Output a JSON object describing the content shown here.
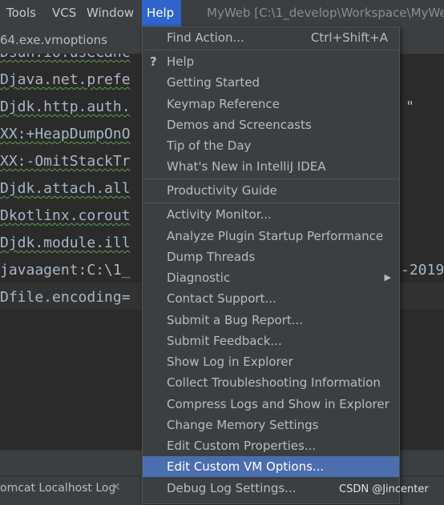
{
  "menubar": {
    "items": [
      {
        "label": "Tools"
      },
      {
        "label": "VCS"
      },
      {
        "label": "Window"
      },
      {
        "label": "Help"
      }
    ],
    "window_title": "MyWeb [C:\\1_develop\\Workspace\\MyWe"
  },
  "editor": {
    "tab_label": "64.exe.vmoptions",
    "lines": [
      "Dsun.io.useCanc",
      "Djava.net.prefe",
      "Djdk.http.auth.",
      "XX:+HeapDumpOnO",
      "XX:-OmitStackTr",
      "Djdk.attach.all",
      "Dkotlinx.corout",
      "Djdk.module.ill",
      "javaagent:C:\\1_",
      "Dfile.encoding="
    ],
    "right_fragments": {
      "quote": "\"",
      "javaagent_tail": "-2019"
    }
  },
  "bottom": {
    "tab_label": "omcat Localhost Log",
    "close_glyph": "✕"
  },
  "help_menu": {
    "items": [
      {
        "label": "Find Action...",
        "shortcut": "Ctrl+Shift+A"
      },
      {
        "label": "Help",
        "icon": "question-icon",
        "icon_glyph": "?"
      },
      {
        "label": "Getting Started"
      },
      {
        "label": "Keymap Reference"
      },
      {
        "label": "Demos and Screencasts"
      },
      {
        "label": "Tip of the Day"
      },
      {
        "label": "What's New in IntelliJ IDEA"
      },
      {
        "label": "Productivity Guide"
      },
      {
        "label": "Activity Monitor..."
      },
      {
        "label": "Analyze Plugin Startup Performance"
      },
      {
        "label": "Dump Threads"
      },
      {
        "label": "Diagnostic",
        "submenu": true,
        "arrow_glyph": "▶"
      },
      {
        "label": "Contact Support..."
      },
      {
        "label": "Submit a Bug Report..."
      },
      {
        "label": "Submit Feedback..."
      },
      {
        "label": "Show Log in Explorer"
      },
      {
        "label": "Collect Troubleshooting Information"
      },
      {
        "label": "Compress Logs and Show in Explorer"
      },
      {
        "label": "Change Memory Settings"
      },
      {
        "label": "Edit Custom Properties..."
      },
      {
        "label": "Edit Custom VM Options...",
        "selected": true
      },
      {
        "label": "Debug Log Settings..."
      }
    ]
  },
  "watermark": "CSDN @Jincenter",
  "colors": {
    "menubar_bg": "#3c3f41",
    "editor_bg": "#2b2b2b",
    "active_menu": "#2f65ca",
    "selected_item": "#4b6eaf",
    "text": "#bbbbbb"
  }
}
